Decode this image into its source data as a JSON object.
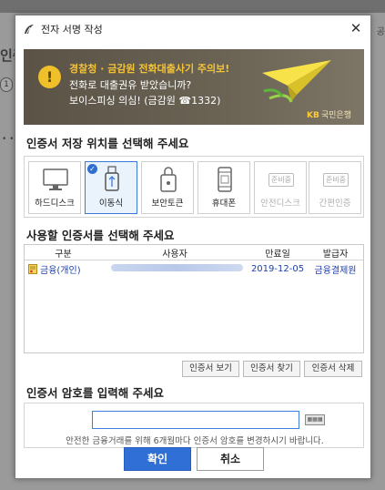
{
  "background": {
    "left_text": "인증",
    "left_circle": "1",
    "left_dots": "• •",
    "right_text": "공"
  },
  "dialog": {
    "title": "전자 서명 작성",
    "close_label": "✕"
  },
  "banner": {
    "line1": "경찰청 · 금감원 전화대출사기 주의보!",
    "line2": "전화로 대출권유 받았습니까?",
    "line3": "보이스피싱 의심! (금감원 ☎1332)",
    "bank_mark": "KB",
    "bank_name": "국민은행"
  },
  "storage": {
    "heading": "인증서 저장 위치를 선택해 주세요",
    "items": [
      {
        "label": "하드디스크",
        "icon": "monitor-icon",
        "state": "normal"
      },
      {
        "label": "이동식",
        "icon": "usb-icon",
        "state": "selected"
      },
      {
        "label": "보안토큰",
        "icon": "token-lock-icon",
        "state": "normal"
      },
      {
        "label": "휴대폰",
        "icon": "phone-icon",
        "state": "normal"
      },
      {
        "label": "안전디스크",
        "icon": "coming-soon-icon",
        "state": "disabled",
        "tag": "준비중"
      },
      {
        "label": "간편인증",
        "icon": "coming-soon-icon",
        "state": "disabled",
        "tag": "준비중"
      }
    ]
  },
  "certs": {
    "heading": "사용할 인증서를 선택해 주세요",
    "columns": [
      "구분",
      "사용자",
      "만료일",
      "발급자"
    ],
    "rows": [
      {
        "type": "금융(개인)",
        "expiry": "2019-12-05",
        "issuer": "금융결제원"
      }
    ],
    "buttons": [
      "인증서 보기",
      "인증서 찾기",
      "인증서 삭제"
    ]
  },
  "password": {
    "heading": "인증서 암호를 입력해 주세요",
    "value": "",
    "hint": "안전한 금융거래를 위해 6개월마다 인증서 암호를 변경하시기 바랍니다."
  },
  "actions": {
    "ok": "확인",
    "cancel": "취소"
  },
  "colors": {
    "accent": "#2f6fd6",
    "banner_bg": "#5f5849",
    "banner_highlight": "#f3c33a",
    "link": "#1b3ea8"
  }
}
